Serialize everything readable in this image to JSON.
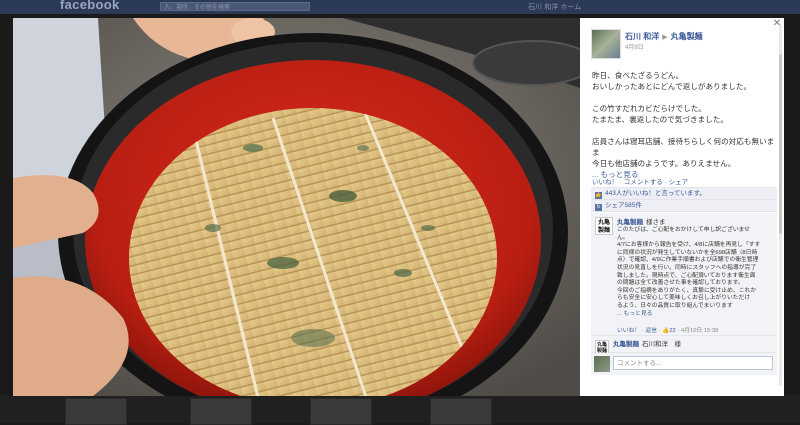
{
  "background": {
    "logo": "facebook",
    "search_placeholder": "人、場所、その他を検索",
    "user_text": "石川 和洋  ホーム"
  },
  "photo": {
    "subject": "zaru-soba-mat-photo"
  },
  "post": {
    "author": "石川 和洋",
    "target": "丸亀製麺",
    "date": "4月8日",
    "lines": [
      "昨日、食べたざるうどん。",
      "おいしかったあとにどんで返しがありました。",
      "",
      "この竹すだれカビだらけでした。",
      "たまたま、裏返したので気づきました。",
      "",
      "店員さんは寝耳店舗、接待ちらしく何の対応も無いま",
      "ま",
      "今日も他店舗のようです。ありえません。"
    ],
    "more_label": "... もっと見る",
    "actions": {
      "like": "いいね！",
      "comment": "コメントする",
      "share": "シェア"
    },
    "likes_text": "443人がいいね！と言っています。",
    "shares_text": "シェア585件"
  },
  "comments": [
    {
      "avatar_text": "丸亀製麺",
      "name": "丸亀製麺",
      "suffix": "様さま",
      "body": [
        "このたびは、ご心配をおかけして申し訳ございませ",
        "ん。",
        "4/7にお客様から報告を受け、4/8に店舗を再見し「すす",
        "に同様の状況が発生していないかを全698店舗（8日時",
        "点）で確認、4/9に作業手順書および店舗での衛生管理",
        "状況の見直しを行い、同時にスタッフへの指導が完了",
        "致しました。現時点で、ご心配頂いております衛生面",
        "の問題は全て改善させた事を確認しております。",
        "今回のご指摘をありがたく、真摯に受け止め、これか",
        "らも安全に安心して美味しくお召し上がりいただけ",
        "るよう、日々の品質に取り組んでまいります",
        "... もっと見る"
      ],
      "meta": "いいね！ · 返信",
      "likes": "22",
      "time": "4月10日 15:38"
    },
    {
      "avatar_text": "丸亀製麺",
      "name": "丸亀製麺",
      "suffix": "石川和洋　様"
    }
  ],
  "reply": {
    "placeholder": "コメントする..."
  }
}
